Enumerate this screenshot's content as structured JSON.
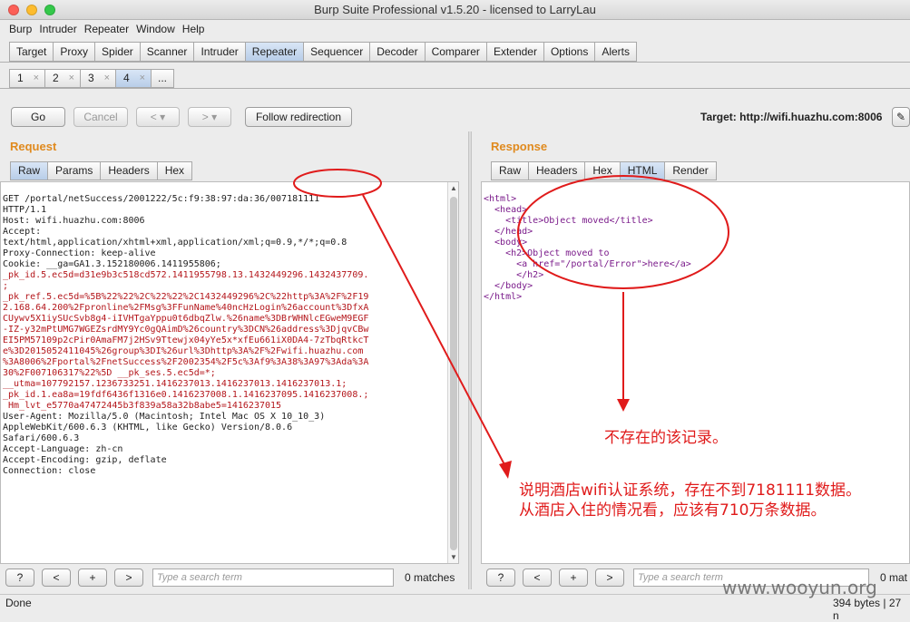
{
  "window": {
    "title": "Burp Suite Professional v1.5.20 - licensed to LarryLau"
  },
  "menu": [
    "Burp",
    "Intruder",
    "Repeater",
    "Window",
    "Help"
  ],
  "main_tabs": [
    "Target",
    "Proxy",
    "Spider",
    "Scanner",
    "Intruder",
    "Repeater",
    "Sequencer",
    "Decoder",
    "Comparer",
    "Extender",
    "Options",
    "Alerts"
  ],
  "repeater_tabs": [
    "1",
    "2",
    "3",
    "4",
    "..."
  ],
  "toolbar": {
    "go": "Go",
    "cancel": "Cancel",
    "back": "<",
    "back_drop": "▾",
    "forward": ">",
    "forward_drop": "▾",
    "follow": "Follow redirection",
    "target": "Target: http://wifi.huazhu.com:8006"
  },
  "request": {
    "title": "Request",
    "tabs": [
      "Raw",
      "Params",
      "Headers",
      "Hex"
    ],
    "lines": [
      "GET /portal/netSuccess/2001222/5c:f9:38:97:da:36/007181111",
      "HTTP/1.1",
      "Host: wifi.huazhu.com:8006",
      "Accept:",
      "text/html,application/xhtml+xml,application/xml;q=0.9,*/*;q=0.8",
      "Proxy-Connection: keep-alive",
      "Cookie: __ga=GA1.3.152180006.1411955806;",
      "_pk_id.5.ec5d=d31e9b3c518cd572.1411955798.13.1432449296.1432437709.",
      ";",
      "_pk_ref.5.ec5d=%5B%22%22%2C%22%22%2C1432449296%2C%22http%3A%2F%2F19",
      "2.168.64.200%2Fpronline%2FMsg%3FFunName%40ncHzLogin%26account%3DfxA",
      "CUywv5X1iySUcSvb8g4-iIVHTgaYppu0t6dbqZlw.%26name%3DBrWHNlcEGweM9EGF",
      "-IZ-y32mPtUMG7WGEZsrdMY9Yc0gQAimD%26country%3DCN%26address%3DjqvCBw",
      "EI5PM57109p2cPir0AmaFM7j2HSv9Ttewjx04yYe5x*xfEu661iX0DA4-7zTbqRtkcT",
      "e%3D2015052411045%26group%3DI%26url%3Dhttp%3A%2F%2Fwifi.huazhu.com",
      "%3A8006%2Fportal%2FnetSuccess%2F2002354%2F5c%3Af9%3A38%3A97%3Ada%3A",
      "30%2F007106317%22%5D __pk_ses.5.ec5d=*;",
      "__utma=107792157.1236733251.1416237013.1416237013.1416237013.1;",
      "_pk_id.1.ea8a=19fdf6436f1316e0.1416237008.1.1416237095.1416237008.;",
      " Hm_lvt_e5770a47472445b3f839a58a32b8abe5=1416237015",
      "User-Agent: Mozilla/5.0 (Macintosh; Intel Mac OS X 10_10_3)",
      "AppleWebKit/600.6.3 (KHTML, like Gecko) Version/8.0.6",
      "Safari/600.6.3",
      "Accept-Language: zh-cn",
      "Accept-Encoding: gzip, deflate",
      "Connection: close"
    ]
  },
  "response": {
    "title": "Response",
    "tabs": [
      "Raw",
      "Headers",
      "Hex",
      "HTML",
      "Render"
    ],
    "html_lines": [
      "<html>",
      "  <head>",
      "    <title>Object moved</title>",
      "  </head>",
      "  <body>",
      "    <h2>Object moved to",
      "      <a href=\"/portal/Error\">here</a>",
      "      </h2>",
      "  </body>",
      "</html>"
    ]
  },
  "search": {
    "help": "?",
    "prev": "<",
    "add": "+",
    "next": ">",
    "placeholder": "Type a search term",
    "matches": "0 matches",
    "matches_right": "0 mat"
  },
  "status": {
    "left": "Done",
    "right": "394 bytes | 27 n"
  },
  "annotations": {
    "note1": "不存在的该记录。",
    "note2_line1": "说明酒店wifi认证系统，存在不到7181111数据。",
    "note2_line2": "从酒店入住的情况看，应该有710万条数据。"
  },
  "watermark": "www.wooyun.org",
  "colors": {
    "annotation": "#e01b1b",
    "panel_title": "#e08a1e",
    "active_tab": "#c4d6ee"
  }
}
